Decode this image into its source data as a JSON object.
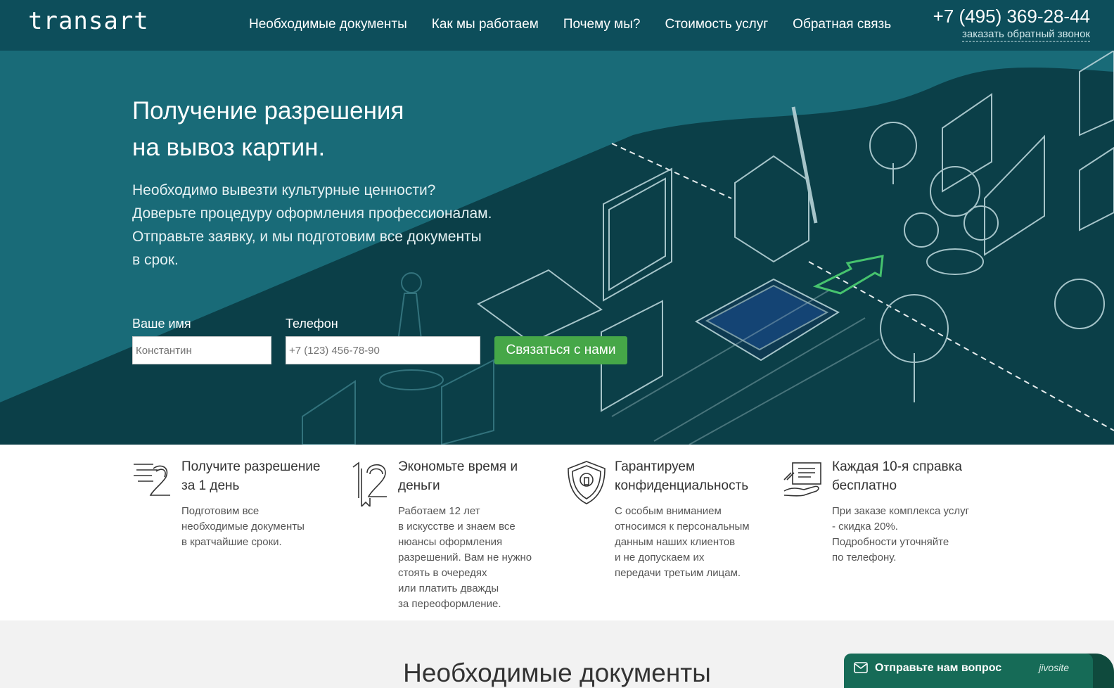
{
  "header": {
    "logo": "transart",
    "nav": [
      {
        "label": "Необходимые документы"
      },
      {
        "label": "Как мы работаем"
      },
      {
        "label": "Почему мы?"
      },
      {
        "label": "Стоимость услуг"
      },
      {
        "label": "Обратная связь"
      }
    ],
    "phone": "+7 (495) 369-28-44",
    "callback": "заказать обратный звонок"
  },
  "hero": {
    "title_line1": "Получение разрешения",
    "title_line2": "на вывоз картин.",
    "lead_line1": "Необходимо вывезти культурные ценности?",
    "lead_line2": "Доверьте процедуру оформления профессионалам.",
    "lead_line3": "Отправьте заявку, и мы подготовим все документы",
    "lead_line4": "в срок."
  },
  "form": {
    "name_label": "Ваше имя",
    "name_placeholder": "Константин",
    "phone_label": "Телефон",
    "phone_placeholder": "+7 (123) 456-78-90",
    "submit": "Связаться с нами"
  },
  "features": [
    {
      "icon": "fast-delivery-icon",
      "title": "Получите разрешение за 1 день",
      "text": "Подготовим все\nнеобходимые документы\nв кратчайшие сроки."
    },
    {
      "icon": "twelve-years-icon",
      "title": "Экономьте время и деньги",
      "text": "Работаем 12 лет\nв искусстве и знаем все\nнюансы оформления\nразрешений. Вам не нужно\nстоять в очередях\nили платить дважды\nза переоформление."
    },
    {
      "icon": "shield-lock-icon",
      "title": "Гарантируем конфиденциальность",
      "text": "С особым вниманием\nотносимся к персональным\nданным наших клиентов\nи не допускаем их\nпередачи третьим лицам."
    },
    {
      "icon": "document-hand-icon",
      "title": "Каждая 10-я справка бесплатно",
      "text": "При заказе комплекса услуг\n- скидка 20%.\nПодробности уточняйте\nпо телефону."
    }
  ],
  "section": {
    "title": "Необходимые документы"
  },
  "chat": {
    "label": "Отправьте нам вопрос",
    "brand": "jivosite"
  },
  "colors": {
    "header": "#0d4e5b",
    "hero": "#0b3f48",
    "hero_band": "#196b78",
    "button": "#46a748",
    "chat": "#166b57"
  }
}
